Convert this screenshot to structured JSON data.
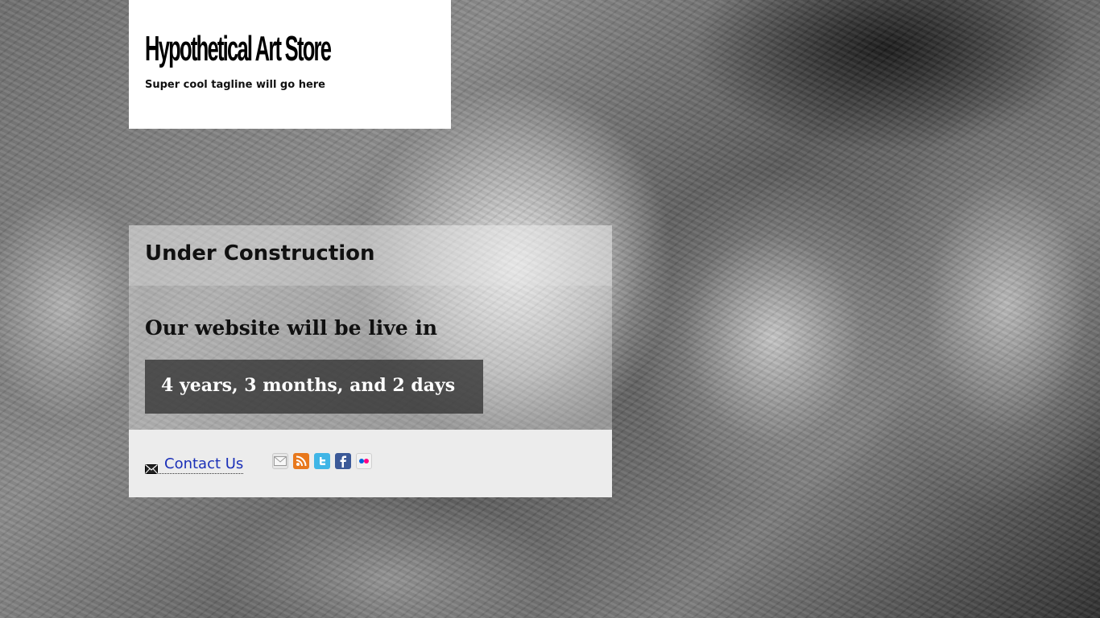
{
  "header": {
    "site_title": "Hypothetical Art Store",
    "tagline": "Super cool tagline will go here"
  },
  "panel": {
    "title": "Under Construction",
    "live_text": "Our website will be live in",
    "countdown": "4 years, 3 months, and 2 days"
  },
  "footer": {
    "contact_label": "Contact Us",
    "social": [
      {
        "icon": "email-icon",
        "color": "#e6e6e6"
      },
      {
        "icon": "rss-icon",
        "color": "#e8781c"
      },
      {
        "icon": "twitter-icon",
        "color": "#3fb5e6"
      },
      {
        "icon": "facebook-icon",
        "color": "#3b5998"
      },
      {
        "icon": "flickr-icon",
        "color": "#f2f2f2"
      }
    ]
  },
  "colors": {
    "link": "#1a2fb8",
    "countdown_bg": "#323232",
    "header_bg": "#ffffff"
  }
}
